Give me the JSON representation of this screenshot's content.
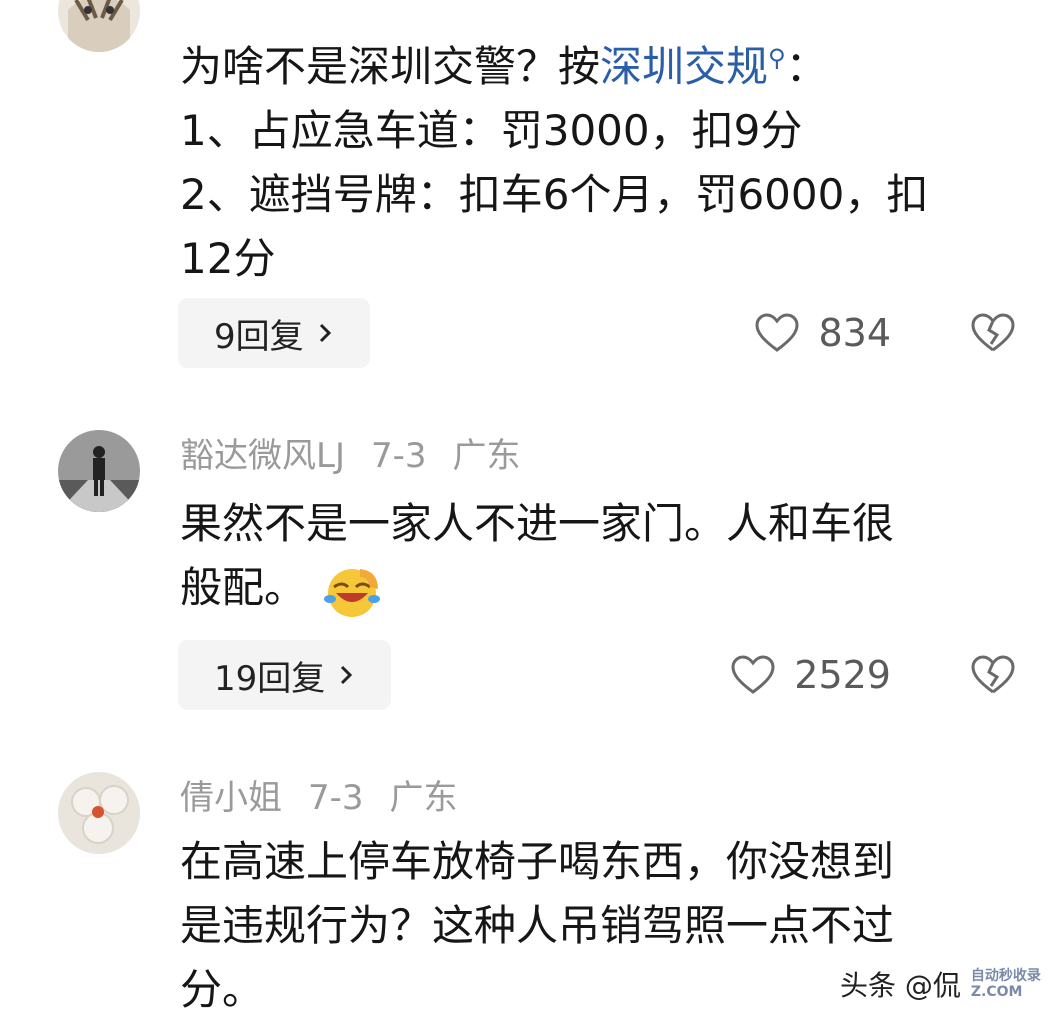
{
  "comments": [
    {
      "user": "",
      "lines": [
        "为啥不是深圳交警？按",
        "1、占应急车道：罚3000，扣9分",
        "2、遮挡号牌：扣车6个月，罚6000，扣",
        "12分"
      ],
      "link_text": "深圳交规",
      "link_suffix": "：",
      "replies": "9回复",
      "likes": "834"
    },
    {
      "user": "豁达微风LJ",
      "date": "7-3",
      "region": "广东",
      "lines": [
        "果然不是一家人不进一家门。人和车很",
        "般配。"
      ],
      "replies": "19回复",
      "likes": "2529"
    },
    {
      "user": "倩小姐",
      "date": "7-3",
      "region": "广东",
      "lines": [
        "在高速上停车放椅子喝东西，你没想到",
        "是违规行为？这种人吊销驾照一点不过",
        "分。"
      ]
    }
  ],
  "watermark": {
    "text": "头条 @侃",
    "logo_line1": "自动秒收录",
    "logo_line2": "Z.COM"
  },
  "colors": {
    "link": "#2a5ea8",
    "meta": "#9a9a9a",
    "reply_bg": "#f4f4f4"
  }
}
